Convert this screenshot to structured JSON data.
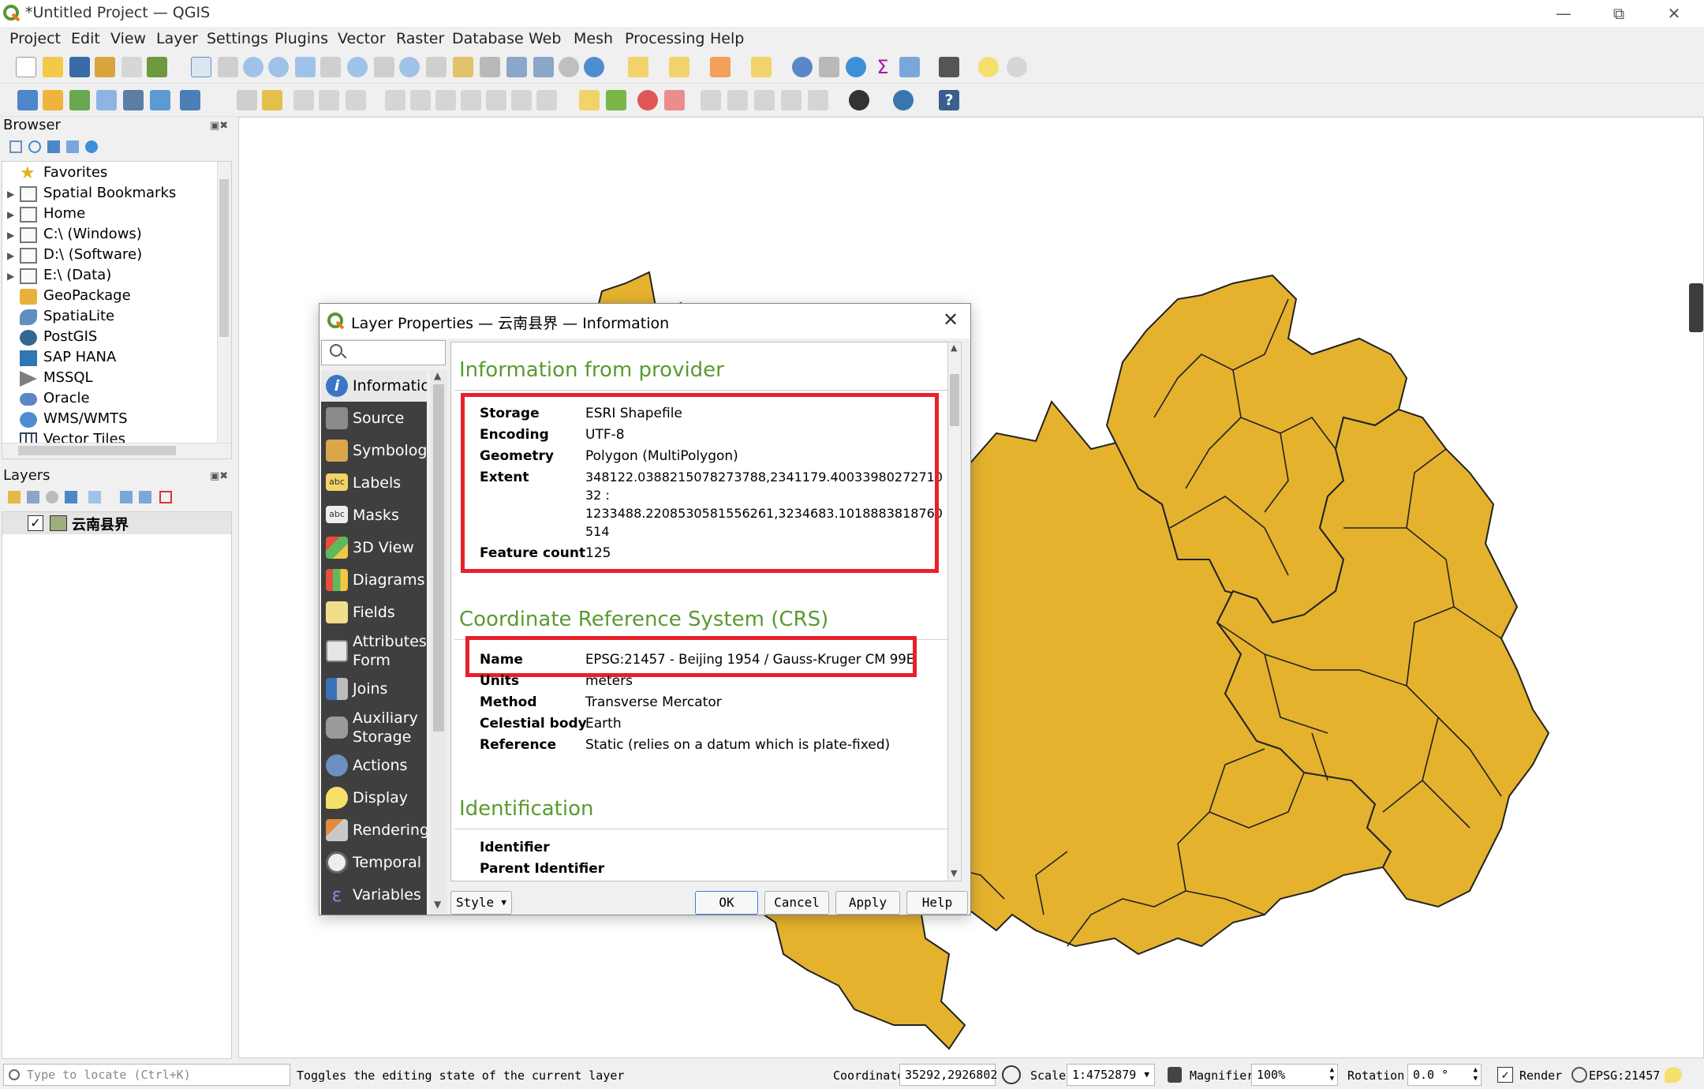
{
  "app": {
    "title": "*Untitled Project — QGIS",
    "window_controls": [
      "minimize",
      "restore",
      "close"
    ]
  },
  "menu": [
    "Project",
    "Edit",
    "View",
    "Layer",
    "Settings",
    "Plugins",
    "Vector",
    "Raster",
    "Database",
    "Web",
    "Mesh",
    "Processing",
    "Help"
  ],
  "browser": {
    "title": "Browser",
    "items": [
      {
        "label": "Favorites",
        "icon": "star-icon",
        "expand": false
      },
      {
        "label": "Spatial Bookmarks",
        "icon": "bookmark-icon",
        "expand": true
      },
      {
        "label": "Home",
        "icon": "home-folder-icon",
        "expand": true
      },
      {
        "label": "C:\\ (Windows)",
        "icon": "folder-icon",
        "expand": true
      },
      {
        "label": "D:\\ (Software)",
        "icon": "folder-icon",
        "expand": true
      },
      {
        "label": "E:\\ (Data)",
        "icon": "folder-icon",
        "expand": true
      },
      {
        "label": "GeoPackage",
        "icon": "geopackage-icon",
        "expand": false
      },
      {
        "label": "SpatiaLite",
        "icon": "spatialite-icon",
        "expand": false
      },
      {
        "label": "PostGIS",
        "icon": "postgis-icon",
        "expand": false
      },
      {
        "label": "SAP HANA",
        "icon": "sap-hana-icon",
        "expand": false
      },
      {
        "label": "MSSQL",
        "icon": "mssql-icon",
        "expand": false
      },
      {
        "label": "Oracle",
        "icon": "oracle-icon",
        "expand": false
      },
      {
        "label": "WMS/WMTS",
        "icon": "globe-icon",
        "expand": false
      },
      {
        "label": "Vector Tiles",
        "icon": "grid-icon",
        "expand": false
      }
    ]
  },
  "layers": {
    "title": "Layers",
    "items": [
      {
        "label": "云南县界",
        "checked": true,
        "color": "#9caf7c"
      }
    ]
  },
  "dialog": {
    "title": "Layer Properties — 云南县界 — Information",
    "search_placeholder": "",
    "tabs": [
      {
        "label": "Information",
        "icon": "info-icon",
        "active": true
      },
      {
        "label": "Source",
        "icon": "source-icon"
      },
      {
        "label": "Symbology",
        "icon": "symbology-icon"
      },
      {
        "label": "Labels",
        "icon": "labels-icon"
      },
      {
        "label": "Masks",
        "icon": "masks-icon"
      },
      {
        "label": "3D View",
        "icon": "cube-icon"
      },
      {
        "label": "Diagrams",
        "icon": "diagrams-icon"
      },
      {
        "label": "Fields",
        "icon": "fields-icon"
      },
      {
        "label": "Attributes Form",
        "icon": "form-icon"
      },
      {
        "label": "Joins",
        "icon": "joins-icon"
      },
      {
        "label": "Auxiliary Storage",
        "icon": "database-icon"
      },
      {
        "label": "Actions",
        "icon": "actions-icon"
      },
      {
        "label": "Display",
        "icon": "display-icon"
      },
      {
        "label": "Rendering",
        "icon": "brush-icon"
      },
      {
        "label": "Temporal",
        "icon": "clock-icon"
      },
      {
        "label": "Variables",
        "icon": "variables-icon"
      }
    ],
    "sections": {
      "provider_title": "Information from provider",
      "storage_k": "Storage",
      "storage_v": "ESRI Shapefile",
      "encoding_k": "Encoding",
      "encoding_v": "UTF-8",
      "geometry_k": "Geometry",
      "geometry_v": "Polygon (MultiPolygon)",
      "extent_k": "Extent",
      "extent_v1": "348122.0388215078273788,2341179.40033980272710",
      "extent_v2": "32 :",
      "extent_v3": "1233488.2208530581556261,3234683.1018883818760",
      "extent_v4": "514",
      "feature_k": "Feature count",
      "feature_v": "125",
      "crs_title": "Coordinate Reference System (CRS)",
      "name_k": "Name",
      "name_v": "EPSG:21457 - Beijing 1954 / Gauss-Kruger CM 99E",
      "units_k": "Units",
      "units_v": "meters",
      "method_k": "Method",
      "method_v": "Transverse Mercator",
      "celestial_k": "Celestial body",
      "celestial_v": "Earth",
      "reference_k": "Reference",
      "reference_v": "Static (relies on a datum which is plate-fixed)",
      "ident_title": "Identification",
      "identifier_k": "Identifier",
      "parent_k": "Parent Identifier"
    },
    "buttons": {
      "style": "Style",
      "ok": "OK",
      "cancel": "Cancel",
      "apply": "Apply",
      "help": "Help"
    }
  },
  "statusbar": {
    "locate_placeholder": "Type to locate (Ctrl+K)",
    "message": "Toggles the editing state of the current layer",
    "coordinate_label": "Coordinate",
    "coordinate_value": "35292,2926802",
    "scale_label": "Scale",
    "scale_value": "1:4752879",
    "magnifier_label": "Magnifier",
    "magnifier_value": "100%",
    "rotation_label": "Rotation",
    "rotation_value": "0.0 °",
    "render_label": "Render",
    "crs_label": "EPSG:21457"
  },
  "colors": {
    "map_fill": "#e5b22e",
    "accent_green": "#5a9a2f",
    "highlight_red": "#e8202a"
  }
}
